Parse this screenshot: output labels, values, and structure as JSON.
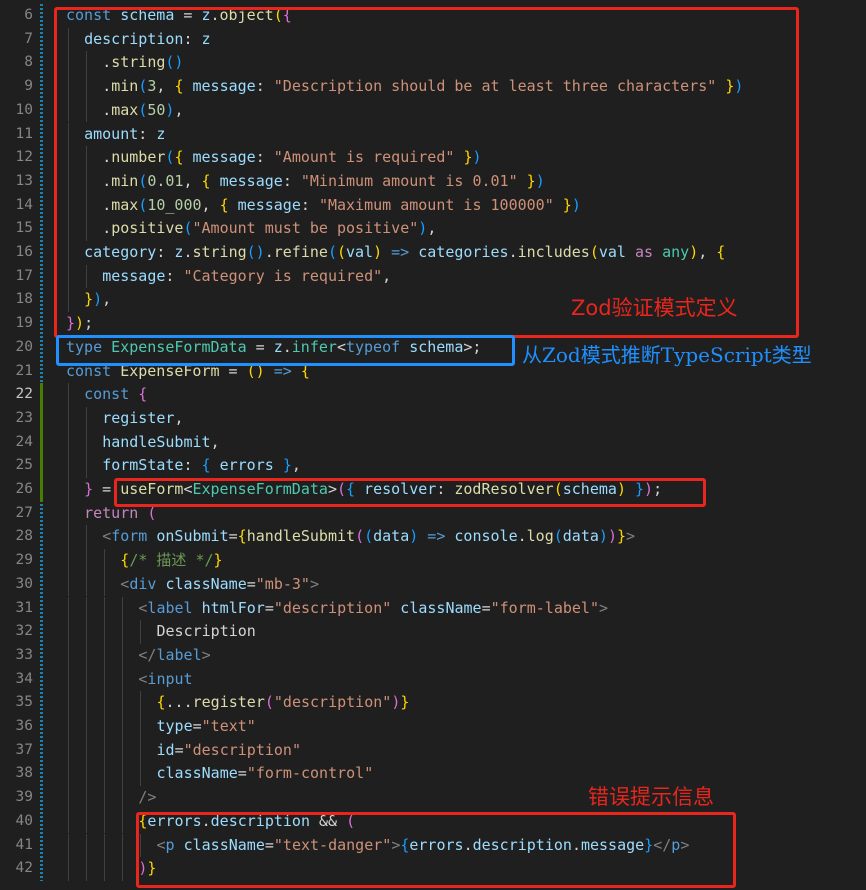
{
  "editor": {
    "line_numbers": [
      6,
      7,
      8,
      9,
      10,
      11,
      12,
      13,
      14,
      15,
      16,
      17,
      18,
      19,
      20,
      21,
      22,
      23,
      24,
      25,
      26,
      27,
      28,
      29,
      30,
      31,
      32,
      33,
      34,
      35,
      36,
      37,
      38,
      39,
      40,
      41,
      42
    ],
    "active_lines": [
      22
    ]
  },
  "lines": [
    {
      "indent": 0,
      "tokens": [
        [
          "const ",
          "t-kw"
        ],
        [
          "schema",
          "t-var"
        ],
        [
          " = ",
          "t-pun"
        ],
        [
          "z",
          "t-var"
        ],
        [
          ".",
          "t-pun"
        ],
        [
          "object",
          "t-fn"
        ],
        [
          "(",
          "t-b1"
        ],
        [
          "{",
          "t-b2"
        ]
      ]
    },
    {
      "indent": 1,
      "tokens": [
        [
          "description",
          "t-var"
        ],
        [
          ": ",
          "t-pun"
        ],
        [
          "z",
          "t-var"
        ]
      ]
    },
    {
      "indent": 2,
      "tokens": [
        [
          ".",
          "t-pun"
        ],
        [
          "string",
          "t-fn"
        ],
        [
          "()",
          "t-b3"
        ]
      ]
    },
    {
      "indent": 2,
      "tokens": [
        [
          ".",
          "t-pun"
        ],
        [
          "min",
          "t-fn"
        ],
        [
          "(",
          "t-b3"
        ],
        [
          "3",
          "t-num"
        ],
        [
          ", ",
          "t-pun"
        ],
        [
          "{",
          "t-b1"
        ],
        [
          " message",
          "t-var"
        ],
        [
          ": ",
          "t-pun"
        ],
        [
          "\"Description should be at least three characters\"",
          "t-str"
        ],
        [
          " ",
          "t-pun"
        ],
        [
          "}",
          "t-b1"
        ],
        [
          ")",
          "t-b3"
        ]
      ]
    },
    {
      "indent": 2,
      "tokens": [
        [
          ".",
          "t-pun"
        ],
        [
          "max",
          "t-fn"
        ],
        [
          "(",
          "t-b3"
        ],
        [
          "50",
          "t-num"
        ],
        [
          ")",
          "t-b3"
        ],
        [
          ",",
          "t-pun"
        ]
      ]
    },
    {
      "indent": 1,
      "tokens": [
        [
          "amount",
          "t-var"
        ],
        [
          ": ",
          "t-pun"
        ],
        [
          "z",
          "t-var"
        ]
      ]
    },
    {
      "indent": 2,
      "tokens": [
        [
          ".",
          "t-pun"
        ],
        [
          "number",
          "t-fn"
        ],
        [
          "(",
          "t-b3"
        ],
        [
          "{",
          "t-b1"
        ],
        [
          " message",
          "t-var"
        ],
        [
          ": ",
          "t-pun"
        ],
        [
          "\"Amount is required\"",
          "t-str"
        ],
        [
          " ",
          "t-pun"
        ],
        [
          "}",
          "t-b1"
        ],
        [
          ")",
          "t-b3"
        ]
      ]
    },
    {
      "indent": 2,
      "tokens": [
        [
          ".",
          "t-pun"
        ],
        [
          "min",
          "t-fn"
        ],
        [
          "(",
          "t-b3"
        ],
        [
          "0.01",
          "t-num"
        ],
        [
          ", ",
          "t-pun"
        ],
        [
          "{",
          "t-b1"
        ],
        [
          " message",
          "t-var"
        ],
        [
          ": ",
          "t-pun"
        ],
        [
          "\"Minimum amount is 0.01\"",
          "t-str"
        ],
        [
          " ",
          "t-pun"
        ],
        [
          "}",
          "t-b1"
        ],
        [
          ")",
          "t-b3"
        ]
      ]
    },
    {
      "indent": 2,
      "tokens": [
        [
          ".",
          "t-pun"
        ],
        [
          "max",
          "t-fn"
        ],
        [
          "(",
          "t-b3"
        ],
        [
          "10_000",
          "t-num"
        ],
        [
          ", ",
          "t-pun"
        ],
        [
          "{",
          "t-b1"
        ],
        [
          " message",
          "t-var"
        ],
        [
          ": ",
          "t-pun"
        ],
        [
          "\"Maximum amount is 100000\"",
          "t-str"
        ],
        [
          " ",
          "t-pun"
        ],
        [
          "}",
          "t-b1"
        ],
        [
          ")",
          "t-b3"
        ]
      ]
    },
    {
      "indent": 2,
      "tokens": [
        [
          ".",
          "t-pun"
        ],
        [
          "positive",
          "t-fn"
        ],
        [
          "(",
          "t-b3"
        ],
        [
          "\"Amount must be positive\"",
          "t-str"
        ],
        [
          ")",
          "t-b3"
        ],
        [
          ",",
          "t-pun"
        ]
      ]
    },
    {
      "indent": 1,
      "tokens": [
        [
          "category",
          "t-var"
        ],
        [
          ": ",
          "t-pun"
        ],
        [
          "z",
          "t-var"
        ],
        [
          ".",
          "t-pun"
        ],
        [
          "string",
          "t-fn"
        ],
        [
          "()",
          "t-b3"
        ],
        [
          ".",
          "t-pun"
        ],
        [
          "refine",
          "t-fn"
        ],
        [
          "(",
          "t-b3"
        ],
        [
          "(",
          "t-b1"
        ],
        [
          "val",
          "t-var"
        ],
        [
          ")",
          "t-b1"
        ],
        [
          " => ",
          "t-kw"
        ],
        [
          "categories",
          "t-var"
        ],
        [
          ".",
          "t-pun"
        ],
        [
          "includes",
          "t-fn"
        ],
        [
          "(",
          "t-b1"
        ],
        [
          "val",
          "t-var"
        ],
        [
          " as ",
          "t-ctl"
        ],
        [
          "any",
          "t-type"
        ],
        [
          ")",
          "t-b1"
        ],
        [
          ", ",
          "t-pun"
        ],
        [
          "{",
          "t-b1"
        ]
      ]
    },
    {
      "indent": 2,
      "tokens": [
        [
          "message",
          "t-var"
        ],
        [
          ": ",
          "t-pun"
        ],
        [
          "\"Category is required\"",
          "t-str"
        ],
        [
          ",",
          "t-pun"
        ]
      ]
    },
    {
      "indent": 1,
      "tokens": [
        [
          "}",
          "t-b1"
        ],
        [
          ")",
          "t-b3"
        ],
        [
          ",",
          "t-pun"
        ]
      ]
    },
    {
      "indent": 0,
      "tokens": [
        [
          "}",
          "t-b2"
        ],
        [
          ")",
          "t-b1"
        ],
        [
          ";",
          "t-pun"
        ]
      ]
    },
    {
      "indent": 0,
      "tokens": [
        [
          "type ",
          "t-kw"
        ],
        [
          "ExpenseFormData",
          "t-type"
        ],
        [
          " = ",
          "t-pun"
        ],
        [
          "z",
          "t-var"
        ],
        [
          ".",
          "t-pun"
        ],
        [
          "infer",
          "t-type"
        ],
        [
          "<",
          "t-pun"
        ],
        [
          "typeof ",
          "t-kw"
        ],
        [
          "schema",
          "t-var"
        ],
        [
          ">",
          "t-pun"
        ],
        [
          ";",
          "t-pun"
        ]
      ]
    },
    {
      "indent": 0,
      "tokens": [
        [
          "const ",
          "t-kw"
        ],
        [
          "ExpenseForm",
          "t-fn"
        ],
        [
          " = ",
          "t-pun"
        ],
        [
          "()",
          "t-b1"
        ],
        [
          " => ",
          "t-kw"
        ],
        [
          "{",
          "t-b1"
        ]
      ]
    },
    {
      "indent": 1,
      "tokens": [
        [
          "const ",
          "t-kw"
        ],
        [
          "{",
          "t-b2"
        ]
      ]
    },
    {
      "indent": 2,
      "tokens": [
        [
          "register",
          "t-var"
        ],
        [
          ",",
          "t-pun"
        ]
      ]
    },
    {
      "indent": 2,
      "tokens": [
        [
          "handleSubmit",
          "t-var"
        ],
        [
          ",",
          "t-pun"
        ]
      ]
    },
    {
      "indent": 2,
      "tokens": [
        [
          "formState",
          "t-var"
        ],
        [
          ": ",
          "t-pun"
        ],
        [
          "{",
          "t-b3"
        ],
        [
          " errors ",
          "t-var"
        ],
        [
          "}",
          "t-b3"
        ],
        [
          ",",
          "t-pun"
        ]
      ]
    },
    {
      "indent": 1,
      "tokens": [
        [
          "}",
          "t-b2"
        ],
        [
          " = ",
          "t-pun"
        ],
        [
          "useForm",
          "t-fn"
        ],
        [
          "<",
          "t-pun"
        ],
        [
          "ExpenseFormData",
          "t-type"
        ],
        [
          ">",
          "t-pun"
        ],
        [
          "(",
          "t-b2"
        ],
        [
          "{",
          "t-b3"
        ],
        [
          " resolver",
          "t-var"
        ],
        [
          ": ",
          "t-pun"
        ],
        [
          "zodResolver",
          "t-fn"
        ],
        [
          "(",
          "t-b1"
        ],
        [
          "schema",
          "t-var"
        ],
        [
          ")",
          "t-b1"
        ],
        [
          " ",
          "t-pun"
        ],
        [
          "}",
          "t-b3"
        ],
        [
          ")",
          "t-b2"
        ],
        [
          ";",
          "t-pun"
        ]
      ]
    },
    {
      "indent": 1,
      "tokens": [
        [
          "return ",
          "t-ctl"
        ],
        [
          "(",
          "t-b2"
        ]
      ]
    },
    {
      "indent": 2,
      "tokens": [
        [
          "<",
          "t-tagp"
        ],
        [
          "form ",
          "t-tag"
        ],
        [
          "onSubmit",
          "t-attr"
        ],
        [
          "=",
          "t-pun"
        ],
        [
          "{",
          "t-b1"
        ],
        [
          "handleSubmit",
          "t-fn"
        ],
        [
          "(",
          "t-b2"
        ],
        [
          "(",
          "t-b3"
        ],
        [
          "data",
          "t-var"
        ],
        [
          ")",
          "t-b3"
        ],
        [
          " => ",
          "t-kw"
        ],
        [
          "console",
          "t-var"
        ],
        [
          ".",
          "t-pun"
        ],
        [
          "log",
          "t-fn"
        ],
        [
          "(",
          "t-b3"
        ],
        [
          "data",
          "t-var"
        ],
        [
          ")",
          "t-b3"
        ],
        [
          ")",
          "t-b2"
        ],
        [
          "}",
          "t-b1"
        ],
        [
          ">",
          "t-tagp"
        ]
      ]
    },
    {
      "indent": 3,
      "tokens": [
        [
          "{",
          "t-b1"
        ],
        [
          "/* 描述 */",
          "t-cmt"
        ],
        [
          "}",
          "t-b1"
        ]
      ]
    },
    {
      "indent": 3,
      "tokens": [
        [
          "<",
          "t-tagp"
        ],
        [
          "div ",
          "t-tag"
        ],
        [
          "className",
          "t-attr"
        ],
        [
          "=",
          "t-pun"
        ],
        [
          "\"mb-3\"",
          "t-str"
        ],
        [
          ">",
          "t-tagp"
        ]
      ]
    },
    {
      "indent": 4,
      "tokens": [
        [
          "<",
          "t-tagp"
        ],
        [
          "label ",
          "t-tag"
        ],
        [
          "htmlFor",
          "t-attr"
        ],
        [
          "=",
          "t-pun"
        ],
        [
          "\"description\"",
          "t-str"
        ],
        [
          " className",
          "t-attr"
        ],
        [
          "=",
          "t-pun"
        ],
        [
          "\"form-label\"",
          "t-str"
        ],
        [
          ">",
          "t-tagp"
        ]
      ]
    },
    {
      "indent": 5,
      "tokens": [
        [
          "Description",
          "t-txt"
        ]
      ]
    },
    {
      "indent": 4,
      "tokens": [
        [
          "</",
          "t-tagp"
        ],
        [
          "label",
          "t-tag"
        ],
        [
          ">",
          "t-tagp"
        ]
      ]
    },
    {
      "indent": 4,
      "tokens": [
        [
          "<",
          "t-tagp"
        ],
        [
          "input",
          "t-tag"
        ]
      ]
    },
    {
      "indent": 5,
      "tokens": [
        [
          "{",
          "t-b1"
        ],
        [
          "...",
          "t-pun"
        ],
        [
          "register",
          "t-fn"
        ],
        [
          "(",
          "t-b2"
        ],
        [
          "\"description\"",
          "t-str"
        ],
        [
          ")",
          "t-b2"
        ],
        [
          "}",
          "t-b1"
        ]
      ]
    },
    {
      "indent": 5,
      "tokens": [
        [
          "type",
          "t-attr"
        ],
        [
          "=",
          "t-pun"
        ],
        [
          "\"text\"",
          "t-str"
        ]
      ]
    },
    {
      "indent": 5,
      "tokens": [
        [
          "id",
          "t-attr"
        ],
        [
          "=",
          "t-pun"
        ],
        [
          "\"description\"",
          "t-str"
        ]
      ]
    },
    {
      "indent": 5,
      "tokens": [
        [
          "className",
          "t-attr"
        ],
        [
          "=",
          "t-pun"
        ],
        [
          "\"form-control\"",
          "t-str"
        ]
      ]
    },
    {
      "indent": 4,
      "tokens": [
        [
          "/>",
          "t-tagp"
        ]
      ]
    },
    {
      "indent": 4,
      "tokens": [
        [
          "{",
          "t-b1"
        ],
        [
          "errors",
          "t-var"
        ],
        [
          ".",
          "t-pun"
        ],
        [
          "description",
          "t-var"
        ],
        [
          " && ",
          "t-pun"
        ],
        [
          "(",
          "t-b2"
        ]
      ]
    },
    {
      "indent": 5,
      "tokens": [
        [
          "<",
          "t-tagp"
        ],
        [
          "p ",
          "t-tag"
        ],
        [
          "className",
          "t-attr"
        ],
        [
          "=",
          "t-pun"
        ],
        [
          "\"text-danger\"",
          "t-str"
        ],
        [
          ">",
          "t-tagp"
        ],
        [
          "{",
          "t-b3"
        ],
        [
          "errors",
          "t-var"
        ],
        [
          ".",
          "t-pun"
        ],
        [
          "description",
          "t-var"
        ],
        [
          ".",
          "t-pun"
        ],
        [
          "message",
          "t-var"
        ],
        [
          "}",
          "t-b3"
        ],
        [
          "</",
          "t-tagp"
        ],
        [
          "p",
          "t-tag"
        ],
        [
          ">",
          "t-tagp"
        ]
      ]
    },
    {
      "indent": 4,
      "tokens": [
        [
          ")",
          "t-b2"
        ],
        [
          "}",
          "t-b1"
        ]
      ]
    }
  ],
  "annotations": {
    "zod_schema_label": "Zod验证模式定义",
    "infer_type_label": "从Zod模式推断TypeScript类型",
    "error_message_label": "错误提示信息"
  },
  "colors": {
    "background": "#1f1f1f",
    "annotation_red": "#e8261d",
    "annotation_blue": "#1e90ff"
  }
}
